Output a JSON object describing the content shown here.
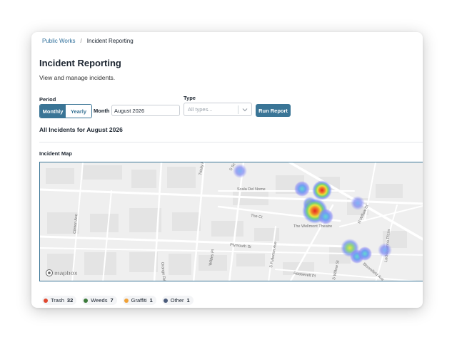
{
  "breadcrumb": {
    "parent": "Public Works",
    "separator": "/",
    "current": "Incident Reporting"
  },
  "page": {
    "title": "Incident Reporting",
    "subtitle": "View and manage incidents."
  },
  "filters": {
    "period_label": "Period",
    "period_options": [
      "Monthly",
      "Yearly"
    ],
    "period_selected": "Monthly",
    "month_label": "Month",
    "month_value": "August 2026",
    "type_label": "Type",
    "type_placeholder": "All types...",
    "run_label": "Run Report"
  },
  "section": {
    "title": "All Incidents for August 2026"
  },
  "map": {
    "title": "Incident Map",
    "attribution": "mapbox",
    "street_labels": [
      "Trinity Pl",
      "S Sc",
      "Scala Del Nome",
      "The Ct",
      "The Wellmont Theatre",
      "N Willow St",
      "Lackawanna Plaza",
      "Clinton Ave",
      "Orange Rd",
      "Wildes Pl",
      "Plymouth St",
      "S Fullerton Ave",
      "Roosevelt Pl",
      "S Willow St",
      "Bloomfield Ave"
    ]
  },
  "legend": [
    {
      "label": "Trash",
      "count": "32",
      "color": "#e0472e"
    },
    {
      "label": "Weeds",
      "count": "7",
      "color": "#3b7a3a"
    },
    {
      "label": "Graffiti",
      "count": "1",
      "color": "#f0a137"
    },
    {
      "label": "Other",
      "count": "1",
      "color": "#4b5b7a"
    }
  ],
  "colors": {
    "accent": "#3a7596",
    "link": "#2f6f9b"
  }
}
